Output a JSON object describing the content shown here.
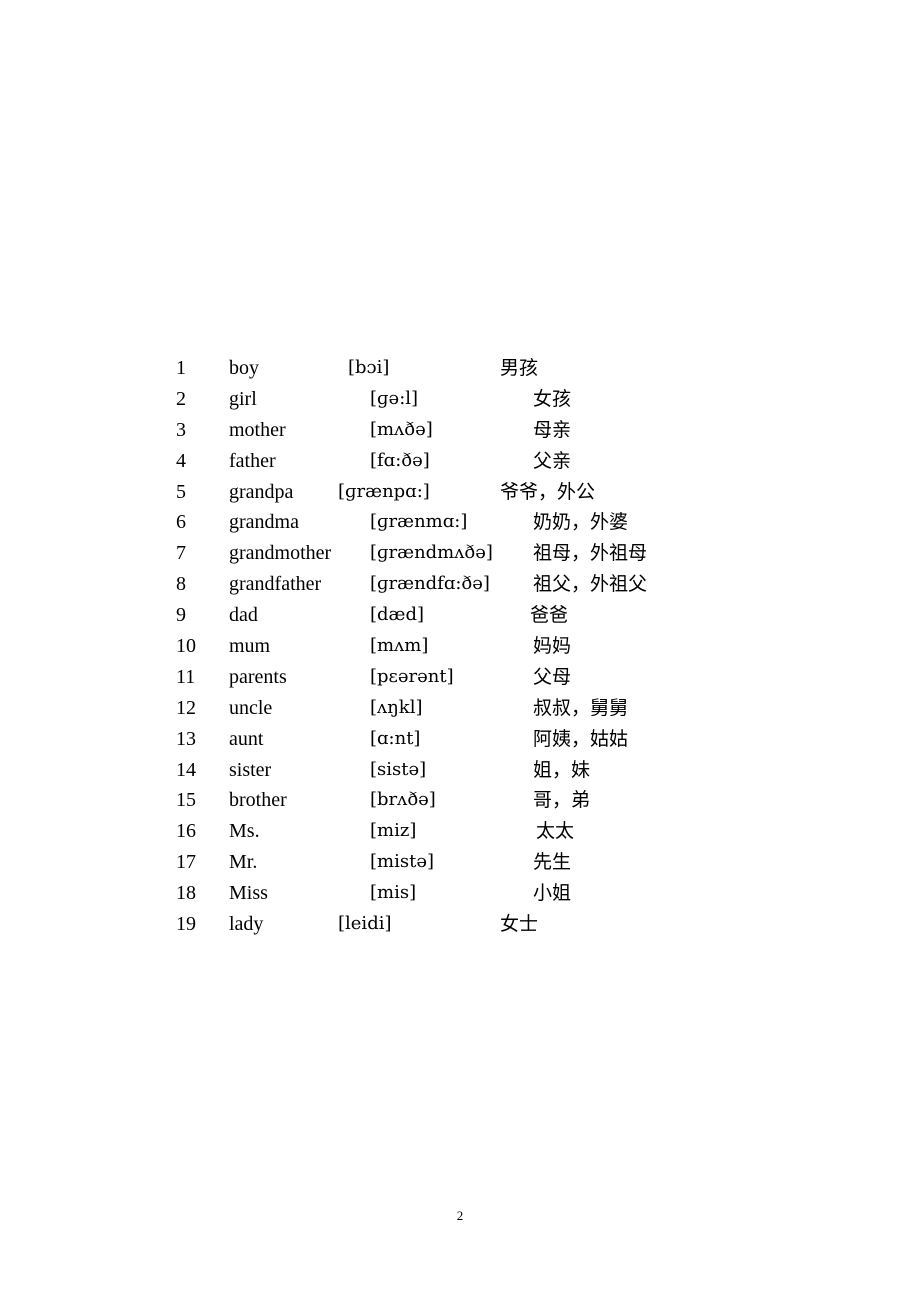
{
  "vocabulary": [
    {
      "num": "1",
      "word": "boy",
      "ipa": "[bɔi]",
      "zh": "男孩"
    },
    {
      "num": "2",
      "word": "girl",
      "ipa": "[ɡə:l]",
      "zh": "女孩"
    },
    {
      "num": "3",
      "word": "mother",
      "ipa": "[mʌðə]",
      "zh": "母亲"
    },
    {
      "num": "4",
      "word": "father",
      "ipa": "[fɑ:ðə]",
      "zh": "父亲"
    },
    {
      "num": "5",
      "word": "grandpa",
      "ipa": "[ɡrænpɑ:]",
      "zh": "爷爷，外公"
    },
    {
      "num": "6",
      "word": "grandma",
      "ipa": "[ɡrænmɑ:]",
      "zh": "奶奶，外婆"
    },
    {
      "num": "7",
      "word": "grandmother",
      "ipa": "[ɡrændmʌðə]",
      "zh": "祖母，外祖母"
    },
    {
      "num": "8",
      "word": "grandfather",
      "ipa": "[ɡrændfɑ:ðə]",
      "zh": "祖父，外祖父"
    },
    {
      "num": "9",
      "word": "dad",
      "ipa": "[dæd]",
      "zh": "爸爸"
    },
    {
      "num": "10",
      "word": "mum",
      "ipa": "[mʌm]",
      "zh": "妈妈"
    },
    {
      "num": "11",
      "word": "parents",
      "ipa": "[pεərənt]",
      "zh": "父母"
    },
    {
      "num": "12",
      "word": "uncle",
      "ipa": "[ʌŋkl]",
      "zh": "叔叔，舅舅"
    },
    {
      "num": "13",
      "word": "aunt",
      "ipa": "[ɑ:nt]",
      "zh": "阿姨，姑姑"
    },
    {
      "num": "14",
      "word": "sister",
      "ipa": "[sistə]",
      "zh": "姐，妹"
    },
    {
      "num": "15",
      "word": "brother",
      "ipa": "[brʌðə]",
      "zh": "哥，弟"
    },
    {
      "num": "16",
      "word": "Ms.",
      "ipa": "[miz]",
      "zh": "太太"
    },
    {
      "num": "17",
      "word": "Mr.",
      "ipa": "[mistə]",
      "zh": "先生"
    },
    {
      "num": "18",
      "word": "Miss",
      "ipa": "[mis]",
      "zh": "小姐"
    },
    {
      "num": "19",
      "word": "lady",
      "ipa": "[leidi]",
      "zh": "女士"
    }
  ],
  "footer": {
    "page_number": "2"
  }
}
